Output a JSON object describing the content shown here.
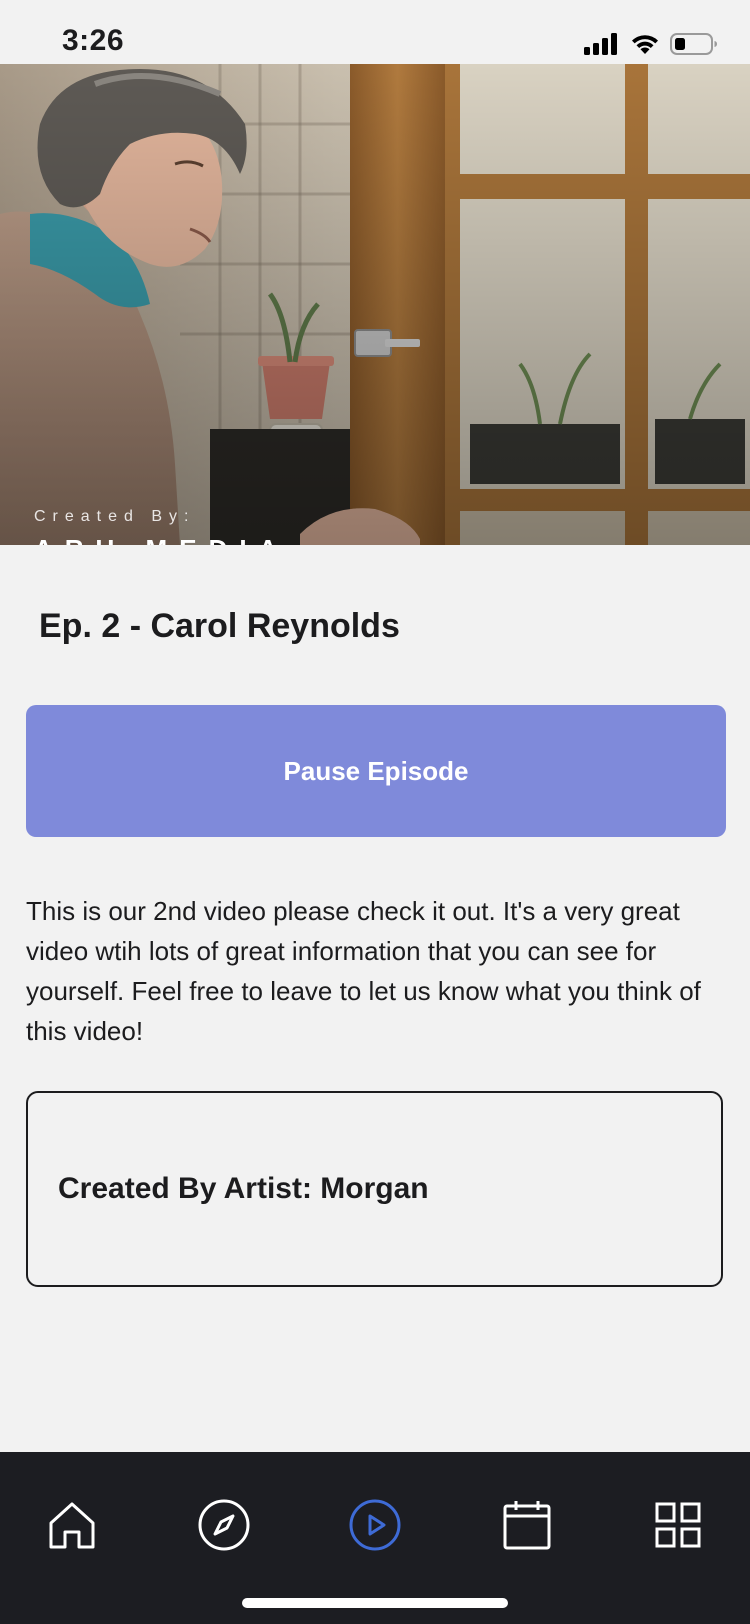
{
  "status_bar": {
    "time": "3:26",
    "icons": [
      "cellular-signal-icon",
      "wifi-icon",
      "battery-icon"
    ]
  },
  "hero": {
    "caption_small": "Created By:",
    "caption_large": "ARU MEDIA"
  },
  "episode": {
    "title": "Ep. 2 - Carol Reynolds",
    "pause_label": "Pause Episode",
    "description": "This is our 2nd video please check it out. It's a very great video wtih lots of great information that you can see for yourself. Feel free to leave to let us know what you think of this video!",
    "artist_label": "Created By Artist: Morgan"
  },
  "tab_bar": {
    "items": [
      {
        "icon": "home-icon",
        "active": false
      },
      {
        "icon": "compass-icon",
        "active": false
      },
      {
        "icon": "play-circle-icon",
        "active": true
      },
      {
        "icon": "calendar-icon",
        "active": false
      },
      {
        "icon": "grid-icon",
        "active": false
      }
    ]
  },
  "colors": {
    "accent": "#7f8ada",
    "active_tab": "#3e6bd6",
    "tab_bar_bg": "#1c1d22",
    "page_bg": "#f2f2f2"
  }
}
